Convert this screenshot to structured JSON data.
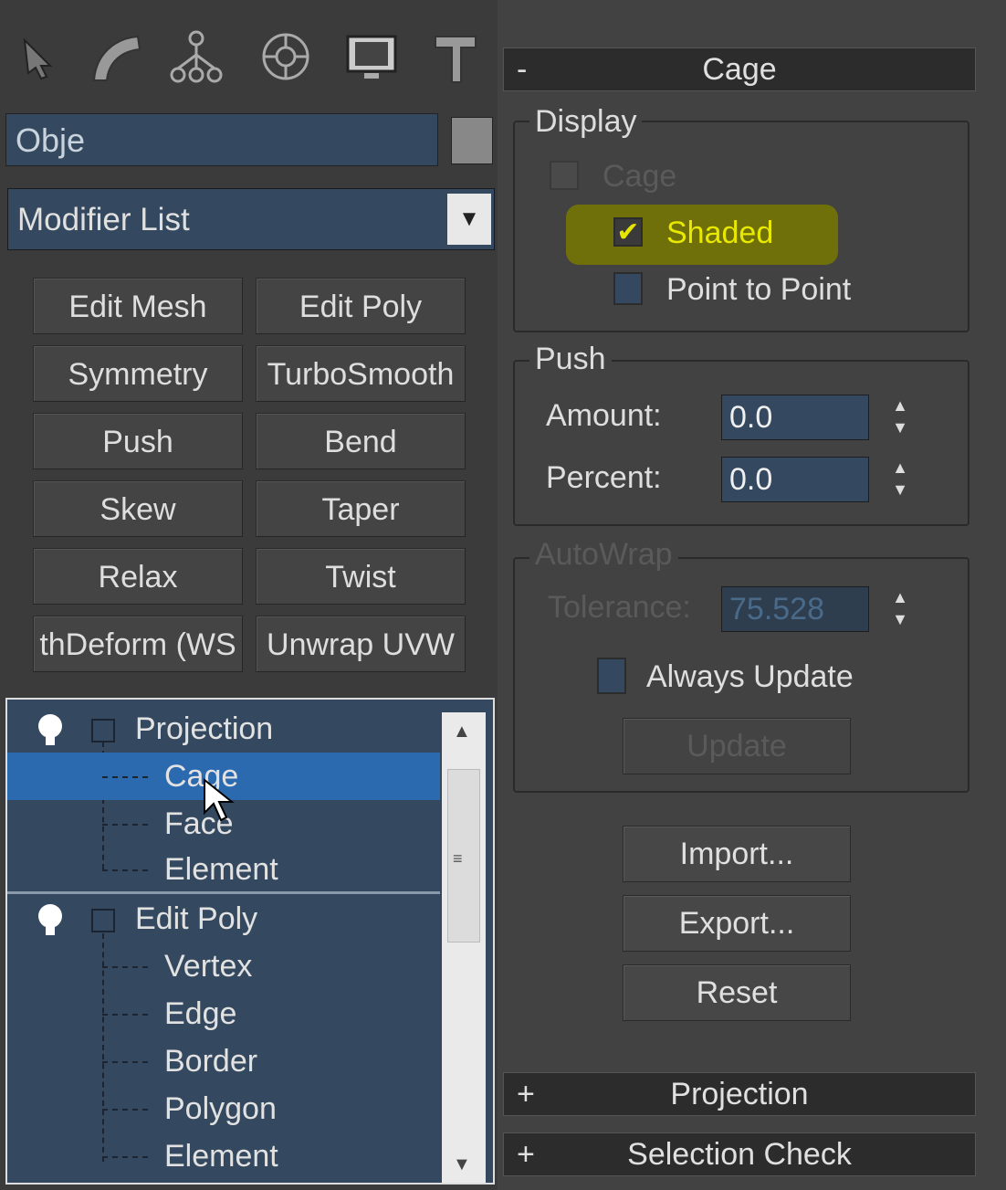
{
  "left_panel": {
    "tabs": [
      {
        "icon": "create-cursor-icon"
      },
      {
        "icon": "modify-arc-icon"
      },
      {
        "icon": "hierarchy-icon"
      },
      {
        "icon": "motion-icon"
      },
      {
        "icon": "display-monitor-icon"
      },
      {
        "icon": "utilities-hammer-icon"
      }
    ],
    "object_name": "Obje",
    "modifier_list": "Modifier List",
    "modifier_buttons": [
      "Edit Mesh",
      "Edit Poly",
      "Symmetry",
      "TurboSmooth",
      "Push",
      "Bend",
      "Skew",
      "Taper",
      "Relax",
      "Twist",
      "thDeform (WS",
      "Unwrap UVW"
    ],
    "stack": {
      "projection": "Projection",
      "projection_items": [
        "Cage",
        "Face",
        "Element"
      ],
      "edit_poly": "Edit Poly",
      "edit_poly_items": [
        "Vertex",
        "Edge",
        "Border",
        "Polygon",
        "Element"
      ]
    }
  },
  "right_panel": {
    "cage_rollout": {
      "sign": "-",
      "title": "Cage"
    },
    "display": {
      "label": "Display",
      "cage": "Cage",
      "shaded": "Shaded",
      "point_to_point": "Point to Point"
    },
    "push": {
      "label": "Push",
      "amount_label": "Amount:",
      "amount_value": "0.0",
      "percent_label": "Percent:",
      "percent_value": "0.0"
    },
    "autowrap": {
      "label": "AutoWrap",
      "tolerance_label": "Tolerance:",
      "tolerance_value": "75.528",
      "always_update": "Always Update",
      "update_button": "Update"
    },
    "import_button": "Import...",
    "export_button": "Export...",
    "reset_button": "Reset",
    "projection_rollout": {
      "sign": "+",
      "title": "Projection"
    },
    "selection_check_rollout": {
      "sign": "+",
      "title": "Selection Check"
    }
  },
  "colors": {
    "field_blue": "#34495f",
    "selection_blue": "#2c6ab0",
    "highlight_yellow": "#c8c800"
  }
}
